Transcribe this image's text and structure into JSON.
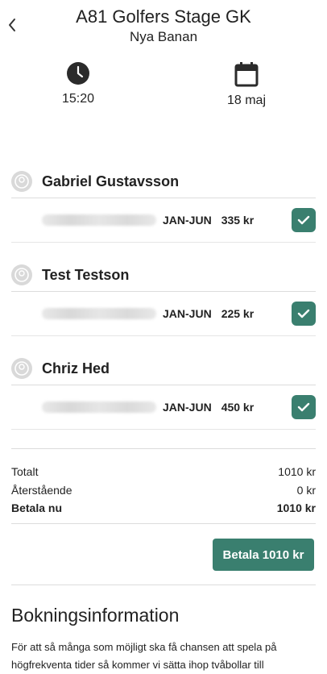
{
  "header": {
    "title": "A81 Golfers Stage GK",
    "subtitle": "Nya Banan"
  },
  "meta": {
    "time": "15:20",
    "date": "18 maj"
  },
  "players": [
    {
      "name": "Gabriel Gustavsson",
      "period": "JAN-JUN",
      "price": "335 kr",
      "checked": true
    },
    {
      "name": "Test Testson",
      "period": "JAN-JUN",
      "price": "225 kr",
      "checked": true
    },
    {
      "name": "Chriz Hed",
      "period": "JAN-JUN",
      "price": "450 kr",
      "checked": true
    }
  ],
  "totals": {
    "total_label": "Totalt",
    "total_value": "1010 kr",
    "remaining_label": "Återstående",
    "remaining_value": "0 kr",
    "pay_now_label": "Betala nu",
    "pay_now_value": "1010 kr"
  },
  "pay_button": "Betala 1010 kr",
  "booking": {
    "title": "Bokningsinformation",
    "text": "För att så många som möjligt ska få chansen att spela på högfrekventa tider så kommer vi sätta ihop tvåbollar till"
  },
  "colors": {
    "accent": "#3a7f6f"
  }
}
